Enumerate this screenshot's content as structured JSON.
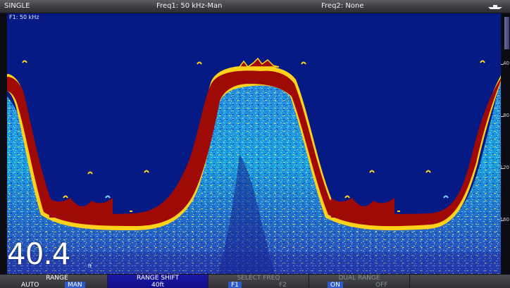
{
  "topbar": {
    "mode": "SINGLE",
    "freq1": "Freq1: 50 kHz-Man",
    "freq2": "Freq2: None"
  },
  "sonar": {
    "channel_label": "F1: 50 kHz",
    "depth_value": "40.4",
    "depth_unit": "ft",
    "scale_labels": [
      "40",
      "80",
      "120",
      "160"
    ]
  },
  "softkeys": {
    "range": {
      "title": "RANGE",
      "opt1": "AUTO",
      "opt2": "MAN"
    },
    "range_shift": {
      "title": "RANGE SHIFT",
      "value": "40ft"
    },
    "select_freq": {
      "title": "SELECT FREQ",
      "opt1": "F1",
      "opt2": "F2"
    },
    "dual_range": {
      "title": "DUAL RANGE",
      "opt1": "ON",
      "opt2": "OFF"
    }
  },
  "colors": {
    "water": "#061a86",
    "bottom": "#a00a06",
    "bottom_edge": "#ffdf1a",
    "active_key": "#1d1aa6"
  }
}
